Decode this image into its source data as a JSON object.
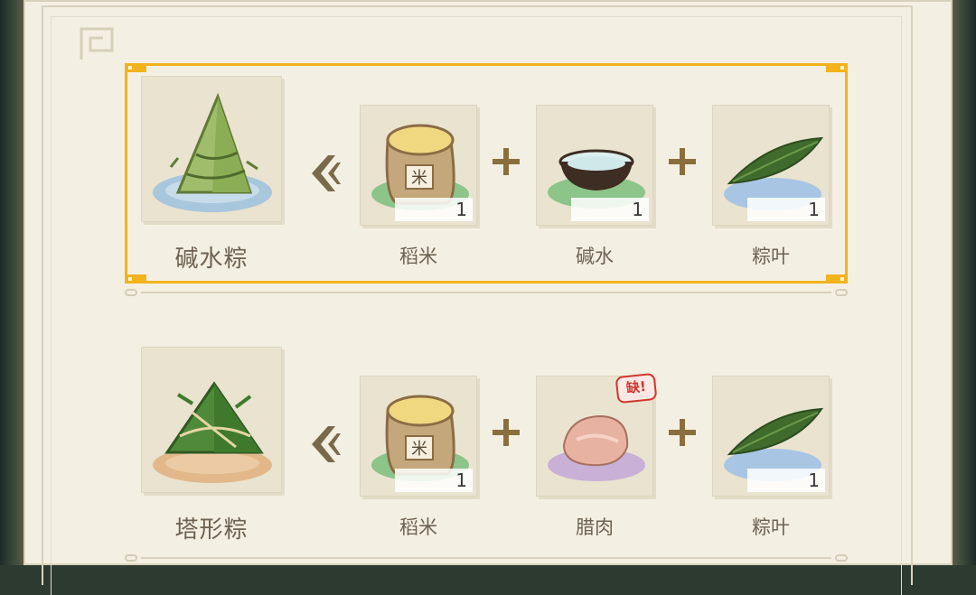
{
  "colors": {
    "selected_border": "#f2b31d",
    "panel_bg": "#f3efe2",
    "card_bg": "#e9e3cf",
    "label_text": "#6e6252",
    "missing_red": "#d2362e"
  },
  "recipes": [
    {
      "name": "碱水粽",
      "selected": true,
      "product_icon": "pyramid-zongzi-icon",
      "ingredients": [
        {
          "name": "稻米",
          "count": "1",
          "icon": "rice-sack-icon",
          "sack_char": "米"
        },
        {
          "name": "碱水",
          "count": "1",
          "icon": "water-bowl-icon"
        },
        {
          "name": "粽叶",
          "count": "1",
          "icon": "bamboo-leaf-icon"
        }
      ]
    },
    {
      "name": "塔形粽",
      "selected": false,
      "product_icon": "tower-zongzi-icon",
      "ingredients": [
        {
          "name": "稻米",
          "count": "1",
          "icon": "rice-sack-icon",
          "sack_char": "米"
        },
        {
          "name": "腊肉",
          "count": "",
          "icon": "cured-meat-icon",
          "badge": "缺!"
        },
        {
          "name": "粽叶",
          "count": "1",
          "icon": "bamboo-leaf-icon"
        }
      ]
    }
  ]
}
